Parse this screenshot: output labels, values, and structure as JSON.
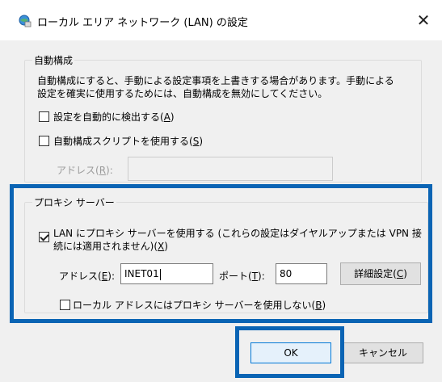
{
  "window": {
    "title": "ローカル エリア ネットワーク (LAN) の設定",
    "close_label": "✕"
  },
  "auto_config": {
    "group_label": "自動構成",
    "description_line1": "自動構成にすると、手動による設定事項を上書きする場合があります。手動による",
    "description_line2": "設定を確実に使用するためには、自動構成を無効にしてください。",
    "auto_detect": {
      "label": "設定を自動的に検出する",
      "accel": "A",
      "checked": false
    },
    "use_script": {
      "label": "自動構成スクリプトを使用する",
      "accel": "S",
      "checked": false
    },
    "address_label": "アドレス",
    "address_accel": "R",
    "address_value": ""
  },
  "proxy": {
    "group_label": "プロキシ サーバー",
    "use_proxy": {
      "label_line1": "LAN にプロキシ サーバーを使用する (これらの設定はダイヤルアップまたは VPN 接",
      "label_line2": "続には適用されません)",
      "accel": "X",
      "checked": true
    },
    "address_label": "アドレス",
    "address_accel": "E",
    "address_value": "INET01",
    "port_label": "ポート",
    "port_accel": "T",
    "port_value": "80",
    "advanced_label": "詳細設定",
    "advanced_accel": "C",
    "bypass_local": {
      "label": "ローカル アドレスにはプロキシ サーバーを使用しない",
      "accel": "B",
      "checked": false
    }
  },
  "buttons": {
    "ok": "OK",
    "cancel": "キャンセル"
  },
  "colors": {
    "highlight": "#0a64b4",
    "dialog_bg": "#f0f0f0",
    "default_button_border": "#0078d7"
  }
}
